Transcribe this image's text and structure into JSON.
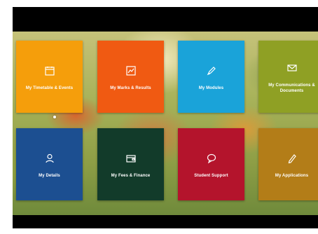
{
  "colors": {
    "frame": "#000000",
    "tile_timetable": "#f59e0b",
    "tile_marks": "#f05a12",
    "tile_modules": "#1aa3d9",
    "tile_documents": "#8fa024",
    "tile_details": "#1c4f91",
    "tile_fees": "#123b2a",
    "tile_support": "#b4142c",
    "tile_applications": "#b37d18"
  },
  "tiles": [
    {
      "label": "My Timetable & Events",
      "icon": "calendar-icon"
    },
    {
      "label": "My Marks & Results",
      "icon": "chart-icon"
    },
    {
      "label": "My Modules",
      "icon": "pen-icon"
    },
    {
      "label": "My Communications & Documents",
      "icon": "mail-icon"
    },
    {
      "label": "My Details",
      "icon": "user-icon"
    },
    {
      "label": "My Fees & Finance",
      "icon": "wallet-icon"
    },
    {
      "label": "Student Support",
      "icon": "chat-icon"
    },
    {
      "label": "My Applications",
      "icon": "pencil-icon"
    }
  ]
}
